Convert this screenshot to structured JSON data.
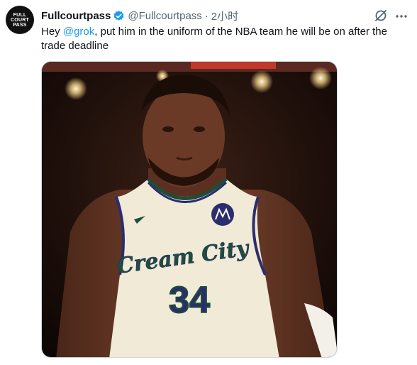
{
  "tweet": {
    "author_name": "Fullcourtpass",
    "handle": "@Fullcourtpass",
    "separator": "·",
    "time": "2小时",
    "avatar_lines": [
      "FULL",
      "COURT",
      "PASS"
    ],
    "text_prefix": "Hey ",
    "mention": "@grok",
    "text_suffix": ", put him in the uniform of the NBA team he will be on after the trade deadline",
    "verified_icon": "verified-badge-icon",
    "grok_icon": "grok-icon",
    "more_icon": "more-options-icon"
  },
  "image": {
    "jersey_text": "Cream City",
    "jersey_number": "34"
  },
  "colors": {
    "accent": "#1d9bf0",
    "secondary_text": "#536471",
    "jersey_cream": "#f0ead6",
    "jersey_trim": "#2b2d6e",
    "jersey_green": "#1e4d3a"
  }
}
